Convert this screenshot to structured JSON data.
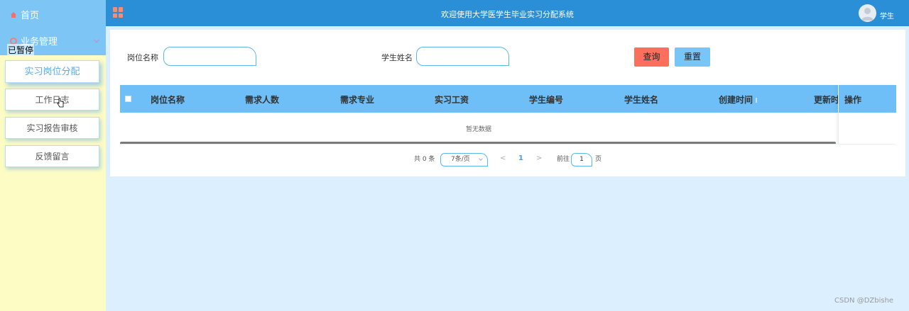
{
  "sidebar": {
    "home": "首页",
    "business": "业务管理",
    "paused_overlay": "已暂停",
    "items": [
      {
        "label": "实习岗位分配"
      },
      {
        "label": "工作日志"
      },
      {
        "label": "实习报告审核"
      },
      {
        "label": "反馈留言"
      }
    ]
  },
  "header": {
    "title": "欢迎使用大学医学生毕业实习分配系统",
    "user": "学生"
  },
  "search": {
    "position_label": "岗位名称",
    "position_value": "",
    "student_label": "学生姓名",
    "student_value": "",
    "query_button": "查询",
    "reset_button": "重置"
  },
  "table": {
    "columns": [
      "岗位名称",
      "需求人数",
      "需求专业",
      "实习工资",
      "学生编号",
      "学生姓名",
      "创建时间",
      "更新时"
    ],
    "op_column": "操作",
    "empty_text": "暂无数据"
  },
  "pagination": {
    "total": "共 0 条",
    "page_size": "7条/页",
    "prev": "<",
    "current": "1",
    "next": ">",
    "goto_label": "前往",
    "goto_value": "1",
    "page_suffix": "页"
  },
  "watermark": "CSDN @DZbishe",
  "colors": {
    "header_bg": "#2a8fd6",
    "sidebar_bg": "#fdfcc4",
    "sidebar_top_bg": "#7cc5f5",
    "table_head_bg": "#6ebef7",
    "query_button_bg": "#fb6f5c",
    "reset_button_bg": "#78c5f8",
    "page_bg": "#dcefff"
  },
  "icons": {
    "home": "home-icon",
    "business": "circle-icon",
    "menu": "grid-menu-icon",
    "avatar": "user-avatar-icon"
  }
}
